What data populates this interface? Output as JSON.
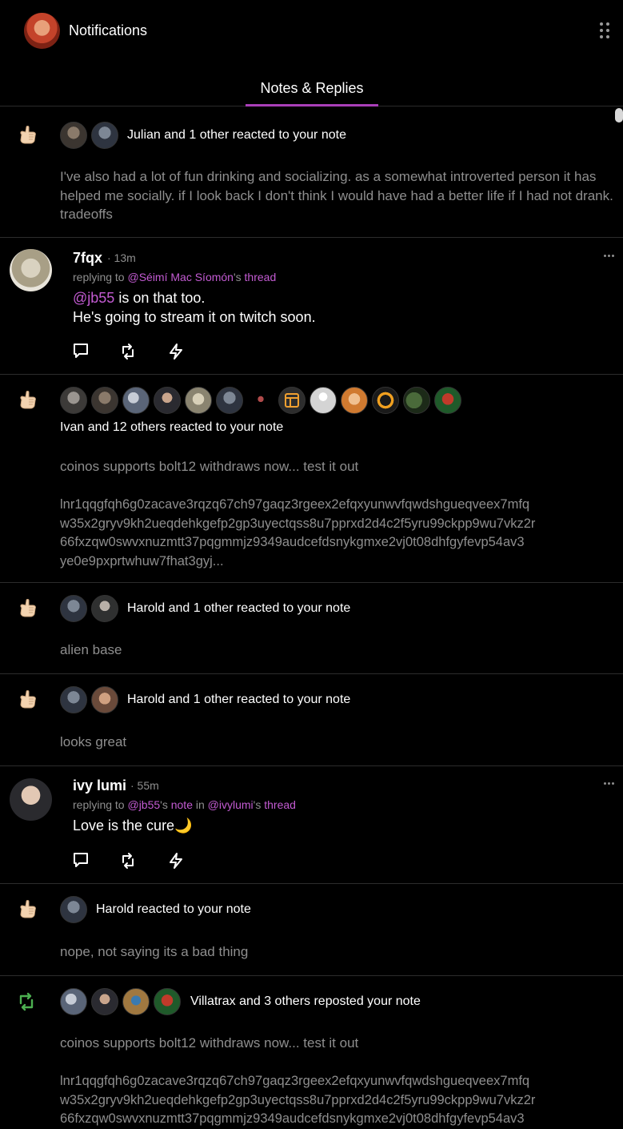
{
  "header": {
    "title": "Notifications"
  },
  "tabs": [
    {
      "label": "Notes & Replies"
    }
  ],
  "notifications": [
    {
      "summary": "Julian and 1 other reacted to your note",
      "note": "I've also had a lot of fun drinking and socializing. as a somewhat introverted person it has helped me socially. if I look back I don't think I would have had a better life if I had not drank. tradeoffs"
    },
    {
      "summary": "Ivan and 12 others reacted to your note",
      "note": "coinos supports bolt12 withdraws now... test it out",
      "note_extra": "lnr1qqgfqh6g0zacave3rqzq67ch97gaqz3rgeex2efqxyunwvfqwdshgueqveex7mfq\nw35x2gryv9kh2ueqdehkgefp2gp3uyectqss8u7pprxd2d4c2f5yru99ckpp9wu7vkz2r\n66fxzqw0swvxnuzmtt37pqgmmjz9349audcefdsnykgmxe2vj0t08dhfgyfevp54av3\nye0e9pxprtwhuw7fhat3gyj..."
    },
    {
      "summary": "Harold and 1 other reacted to your note",
      "note": "alien base"
    },
    {
      "summary": "Harold and 1 other reacted to your note",
      "note": "looks great"
    },
    {
      "summary": "Harold reacted to your note",
      "note": "nope, not saying its a bad thing"
    },
    {
      "summary": "Villatrax and 3 others reposted your note",
      "note": "coinos supports bolt12 withdraws now... test it out",
      "note_extra": "lnr1qqgfqh6g0zacave3rqzq67ch97gaqz3rgeex2efqxyunwvfqwdshgueqveex7mfq\nw35x2gryv9kh2ueqdehkgefp2gp3uyectqss8u7pprxd2d4c2f5yru99ckpp9wu7vkz2r\n66fxzqw0swvxnuzmtt37pqgmmjz9349audcefdsnykgmxe2vj0t08dhfgyfevp54av3"
    }
  ],
  "replies": [
    {
      "author": "7fqx",
      "time": "· 13m",
      "replying_prefix": "replying to ",
      "replying_user": "@Séimí Mac Síomón",
      "replying_mid": "'s ",
      "replying_thread": "thread",
      "mention": "@jb55",
      "line1_rest": " is on that too.",
      "line2": "He's going to stream it on twitch soon."
    },
    {
      "author": "ivy lumi",
      "time": "· 55m",
      "replying_prefix": "replying to ",
      "replying_user": "@jb55",
      "replying_mid": "'s ",
      "replying_note": "note",
      "replying_in": " in ",
      "replying_user2": "@ivylumi",
      "replying_mid2": "'s ",
      "replying_thread": "thread",
      "text": "Love is the cure🌙"
    }
  ],
  "icons": {
    "reaction": "thumb-hand-icon",
    "repost": "repost-icon",
    "reply": "reply-icon",
    "zap": "zap-icon",
    "more": "more-dots-icon"
  },
  "colors": {
    "accent": "#a93fb8",
    "link": "#c35bd2",
    "repost": "#4caf50",
    "muted": "#8e8e8e"
  }
}
